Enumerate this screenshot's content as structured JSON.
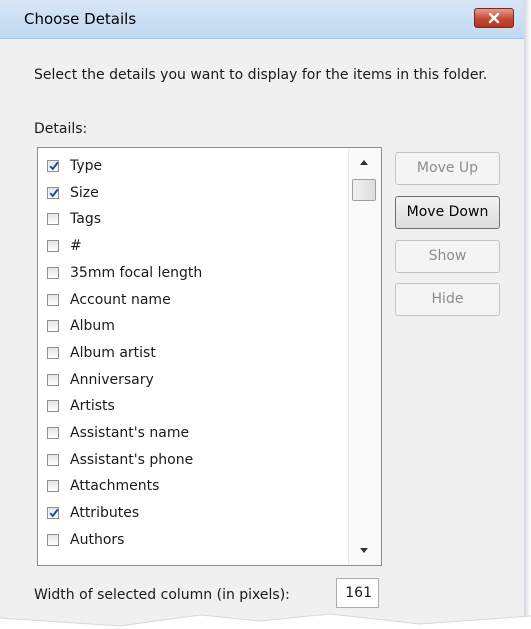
{
  "dialog": {
    "title": "Choose Details",
    "instructions": "Select the details you want to display for the items in this folder.",
    "details_label": "Details:",
    "items": [
      {
        "label": "Type",
        "checked": true
      },
      {
        "label": "Size",
        "checked": true
      },
      {
        "label": "Tags",
        "checked": false
      },
      {
        "label": "#",
        "checked": false
      },
      {
        "label": "35mm focal length",
        "checked": false
      },
      {
        "label": "Account name",
        "checked": false
      },
      {
        "label": "Album",
        "checked": false
      },
      {
        "label": "Album artist",
        "checked": false
      },
      {
        "label": "Anniversary",
        "checked": false
      },
      {
        "label": "Artists",
        "checked": false
      },
      {
        "label": "Assistant's name",
        "checked": false
      },
      {
        "label": "Assistant's phone",
        "checked": false
      },
      {
        "label": "Attachments",
        "checked": false
      },
      {
        "label": "Attributes",
        "checked": true
      },
      {
        "label": "Authors",
        "checked": false
      }
    ],
    "buttons": {
      "move_up": "Move Up",
      "move_down": "Move Down",
      "show": "Show",
      "hide": "Hide"
    },
    "width_label": "Width of selected column (in pixels):",
    "width_value": "161"
  },
  "colors": {
    "titlebar": "#c2d9f1",
    "close_button": "#c44a36",
    "check": "#1c4f9c"
  },
  "icons": {
    "close": "close-icon",
    "check": "checkmark-icon",
    "scroll_up": "scroll-up-arrow-icon",
    "scroll_down": "scroll-down-arrow-icon"
  }
}
